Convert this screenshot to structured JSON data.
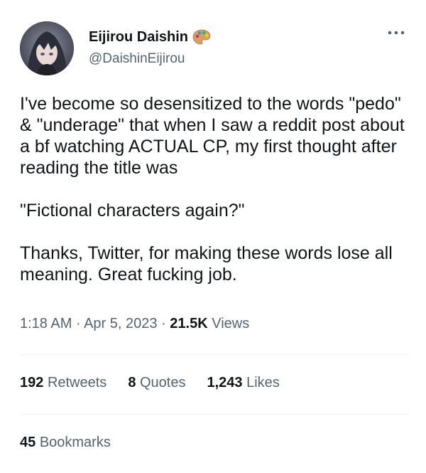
{
  "author": {
    "display_name": "Eijirou Daishin",
    "handle": "@DaishinEijirou",
    "badge_icon": "palette-icon"
  },
  "tweet": {
    "paragraphs": [
      "I've become so desensitized to the words \"pedo\" & \"underage\" that when I saw a reddit post about a bf watching ACTUAL CP, my first thought after reading the title was",
      "\"Fictional characters again?\"",
      "Thanks, Twitter, for making these words lose all meaning. Great fucking job."
    ]
  },
  "meta": {
    "time": "1:18 AM",
    "separator": "·",
    "date": "Apr 5, 2023",
    "views_count": "21.5K",
    "views_label": "Views"
  },
  "stats": {
    "retweets": {
      "count": "192",
      "label": "Retweets"
    },
    "quotes": {
      "count": "8",
      "label": "Quotes"
    },
    "likes": {
      "count": "1,243",
      "label": "Likes"
    }
  },
  "bookmarks": {
    "count": "45",
    "label": "Bookmarks"
  },
  "colors": {
    "text_primary": "#0f1419",
    "text_secondary": "#536471",
    "divider": "#eff3f4"
  }
}
